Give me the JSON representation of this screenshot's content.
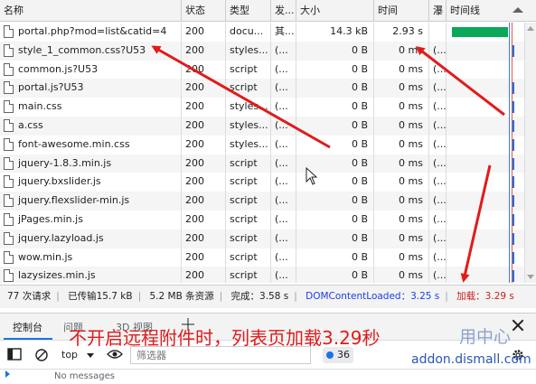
{
  "columns": [
    "名称",
    "状态",
    "类型",
    "发...",
    "大小",
    "时间",
    "瀑",
    "时间线"
  ],
  "rows": [
    {
      "name": "portal.php?mod=list&catid=4",
      "status": "200",
      "type": "docu...",
      "initiator": "其...",
      "size": "14.3 kB",
      "time": "2.93 s",
      "waterfall": "",
      "bar": "green"
    },
    {
      "name": "style_1_common.css?U53",
      "status": "200",
      "type": "styles...",
      "initiator": "(...",
      "size": "0 B",
      "time": "0 ms",
      "waterfall": "(...",
      "bar": "tick"
    },
    {
      "name": "common.js?U53",
      "status": "200",
      "type": "script",
      "initiator": "(...",
      "size": "0 B",
      "time": "0 ms",
      "waterfall": "(...",
      "bar": "none"
    },
    {
      "name": "portal.js?U53",
      "status": "200",
      "type": "script",
      "initiator": "(...",
      "size": "0 B",
      "time": "0 ms",
      "waterfall": "(...",
      "bar": "tick"
    },
    {
      "name": "main.css",
      "status": "200",
      "type": "styles...",
      "initiator": "(...",
      "size": "0 B",
      "time": "0 ms",
      "waterfall": "(...",
      "bar": "tick"
    },
    {
      "name": "a.css",
      "status": "200",
      "type": "styles...",
      "initiator": "(...",
      "size": "0 B",
      "time": "0 ms",
      "waterfall": "(...",
      "bar": "tick"
    },
    {
      "name": "font-awesome.min.css",
      "status": "200",
      "type": "styles...",
      "initiator": "(...",
      "size": "0 B",
      "time": "0 ms",
      "waterfall": "(...",
      "bar": "tick"
    },
    {
      "name": "jquery-1.8.3.min.js",
      "status": "200",
      "type": "script",
      "initiator": "(...",
      "size": "0 B",
      "time": "0 ms",
      "waterfall": "(...",
      "bar": "tick"
    },
    {
      "name": "jquery.bxslider.js",
      "status": "200",
      "type": "script",
      "initiator": "(...",
      "size": "0 B",
      "time": "0 ms",
      "waterfall": "(...",
      "bar": "tick"
    },
    {
      "name": "jquery.flexslider-min.js",
      "status": "200",
      "type": "script",
      "initiator": "(...",
      "size": "0 B",
      "time": "0 ms",
      "waterfall": "(...",
      "bar": "tick"
    },
    {
      "name": "jPages.min.js",
      "status": "200",
      "type": "script",
      "initiator": "(...",
      "size": "0 B",
      "time": "0 ms",
      "waterfall": "(...",
      "bar": "tick"
    },
    {
      "name": "jquery.lazyload.js",
      "status": "200",
      "type": "script",
      "initiator": "(...",
      "size": "0 B",
      "time": "0 ms",
      "waterfall": "(...",
      "bar": "tick"
    },
    {
      "name": "wow.min.js",
      "status": "200",
      "type": "script",
      "initiator": "(...",
      "size": "0 B",
      "time": "0 ms",
      "waterfall": "(...",
      "bar": "tick"
    },
    {
      "name": "lazysizes.min.js",
      "status": "200",
      "type": "script",
      "initiator": "(...",
      "size": "0 B",
      "time": "0 ms",
      "waterfall": "(...",
      "bar": "tick"
    }
  ],
  "status_bar": {
    "requests": "77 次请求",
    "transferred": "已传输15.7 kB",
    "resources": "5.2 MB 条资源",
    "finish": "完成：3.58 s",
    "dom_loaded": "DOMContentLoaded：3.25 s",
    "load": "加载：3.29 s"
  },
  "drawer": {
    "tabs": [
      "控制台",
      "问题",
      "3D 视图"
    ],
    "active_tab": "控制台"
  },
  "console": {
    "context": "top",
    "filter_placeholder": "筛选器",
    "issue_count": "36",
    "no_messages": "No messages"
  },
  "annotation": {
    "caption": "不开启远程附件时，列表页加载3.29秒",
    "watermark_top": "用中心",
    "watermark_bottom": "addon.dismall.com"
  },
  "colors": {
    "accent": "#1a73e8",
    "green_bar": "#0aa858",
    "annotation_red": "#e11b1b",
    "dom_blue": "#1a3ee8",
    "load_red": "#c5221f"
  },
  "icons": [
    "file-icon",
    "sort-arrow-icon",
    "close-icon",
    "sidebar-toggle-icon",
    "clear-console-icon",
    "eye-icon",
    "settings-icon",
    "cursor-icon",
    "issues-icon"
  ]
}
